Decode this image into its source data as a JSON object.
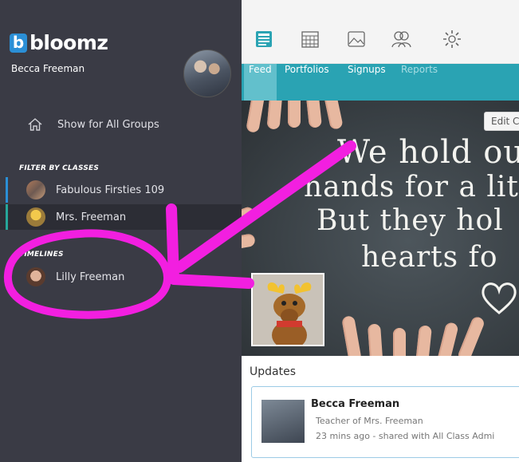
{
  "brand": {
    "mark": "b",
    "name": "bloomz"
  },
  "user": {
    "name": "Becca Freeman"
  },
  "sidebar": {
    "all_groups_label": "Show for All Groups",
    "filter_header": "FILTER BY CLASSES",
    "classes": [
      {
        "label": "Fabulous Firsties 109",
        "color": "#2b8fd6"
      },
      {
        "label": "Mrs. Freeman",
        "color": "#26a69a"
      }
    ],
    "timelines_header": "TIMELINES",
    "timelines": [
      {
        "label": "Lilly Freeman"
      }
    ]
  },
  "toolbar": {
    "icons": [
      "newsfeed-icon",
      "calendar-icon",
      "photos-icon",
      "people-icon",
      "settings-icon"
    ]
  },
  "tabs": [
    {
      "label": "Feed",
      "active": true
    },
    {
      "label": "Portfolios"
    },
    {
      "label": "Signups"
    },
    {
      "label": "Reports",
      "muted": true
    }
  ],
  "hero": {
    "edit_label": "Edit C",
    "chalk_lines": [
      "We hold our",
      "hands for a litt",
      "But they hol",
      "hearts fo"
    ]
  },
  "updates": {
    "header": "Updates",
    "post": {
      "author": "Becca Freeman",
      "role": "Teacher of Mrs. Freeman",
      "meta": "23 mins ago - shared with All Class Admi"
    }
  },
  "colors": {
    "sidebar": "#3a3b45",
    "tabs": "#2aa3b3",
    "annotation": "#f21fe0",
    "brand": "#2b8fd6"
  }
}
